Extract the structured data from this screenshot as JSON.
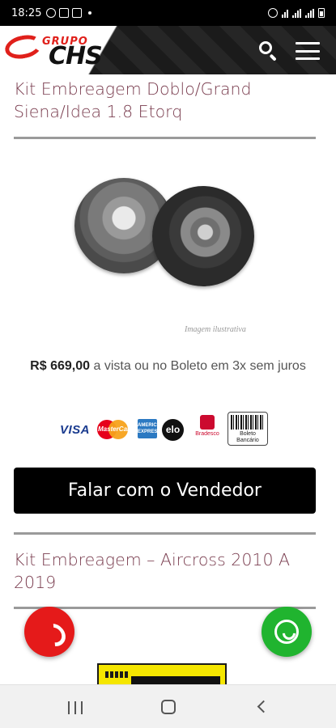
{
  "status_bar": {
    "time": "18:25",
    "left_icons": [
      "whatsapp-notification-icon",
      "image-notification-icon",
      "cast-notification-icon",
      "dot-notification-icon"
    ],
    "right_icons": [
      "alarm-icon",
      "wifi-icon",
      "signal-icon",
      "signal-icon",
      "battery-icon"
    ]
  },
  "header": {
    "logo_grupo": "GRUPO",
    "logo_chs": "CHS",
    "background_color": "#1f1f1f",
    "brand_red": "#e0201b"
  },
  "product": {
    "title": "Kit Embreagem Doblo/Grand Siena/Idea 1.8 Etorq",
    "image_caption": "Imagem ilustrativa",
    "price_amount": "R$ 669,00",
    "price_terms": "a vista ou no Boleto em 3x sem juros",
    "payment_methods": {
      "visa": "VISA",
      "mastercard": "MasterCard",
      "amex": "AMERICAN EXPRESS",
      "elo": "elo",
      "bradesco": "Bradesco",
      "boleto": "Boleto Bancário"
    },
    "cta_label": "Falar com o Vendedor"
  },
  "next_product": {
    "title": "Kit Embreagem – Aircross 2010 A 2019"
  },
  "floating": {
    "call_color": "#e51a1a",
    "whatsapp_color": "#20b42f"
  },
  "title_color": "#7a3d4f"
}
